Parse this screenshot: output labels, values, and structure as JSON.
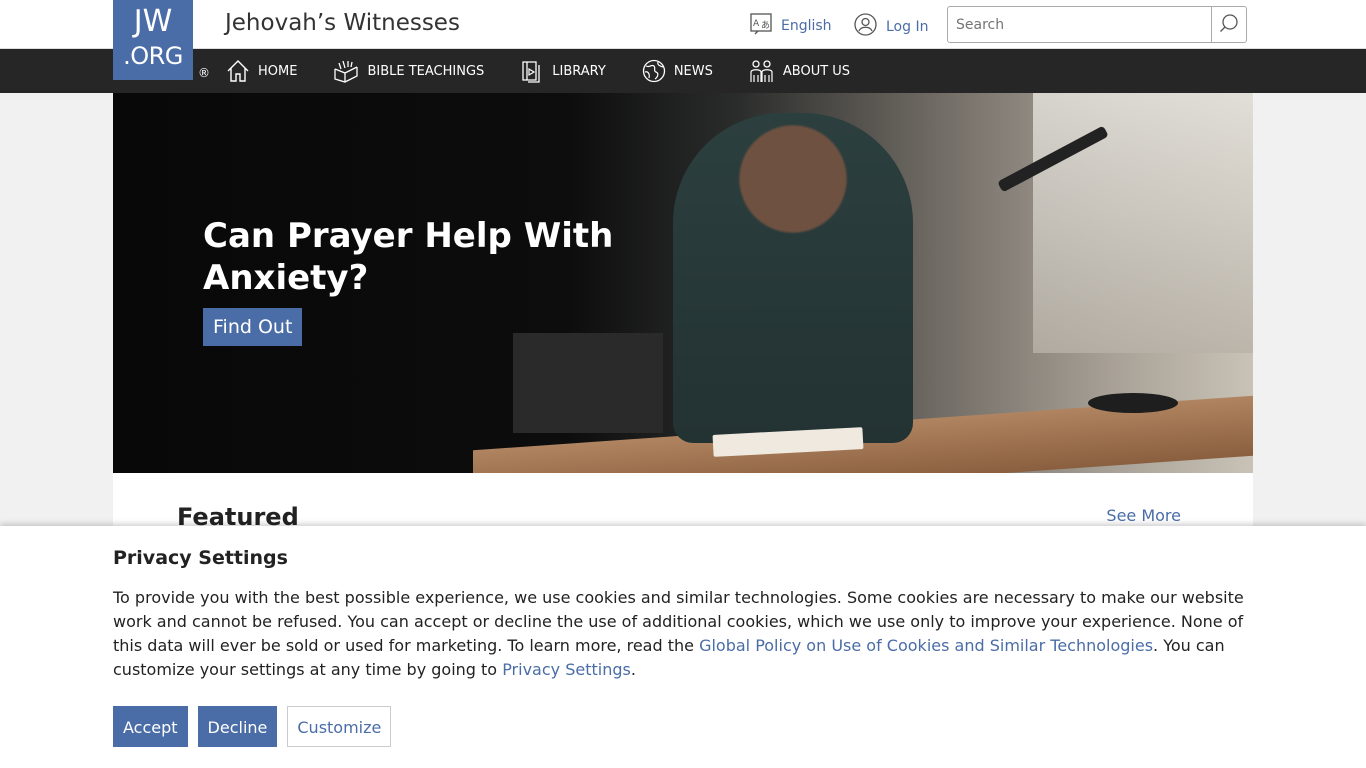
{
  "header": {
    "logo_line1": "JW",
    "logo_line2": ".ORG",
    "registered": "®",
    "site_title": "Jehovah’s Witnesses",
    "language_label": "English",
    "login_label": "Log In",
    "search_placeholder": "Search"
  },
  "nav": {
    "items": [
      {
        "label": "HOME",
        "icon": "home-icon"
      },
      {
        "label": "BIBLE TEACHINGS",
        "icon": "bible-icon"
      },
      {
        "label": "LIBRARY",
        "icon": "library-icon"
      },
      {
        "label": "NEWS",
        "icon": "globe-icon"
      },
      {
        "label": "ABOUT US",
        "icon": "people-icon"
      }
    ]
  },
  "hero": {
    "title": "Can Prayer Help With Anxiety?",
    "cta": "Find Out"
  },
  "featured": {
    "heading": "Featured",
    "see_more": "See More"
  },
  "cookie": {
    "title": "Privacy Settings",
    "text_before_link": "To provide you with the best possible experience, we use cookies and similar technologies. Some cookies are necessary to make our website work and cannot be refused. You can accept or decline the use of additional cookies, which we use only to improve your experience. None of this data will ever be sold or used for marketing. To learn more, read the ",
    "policy_link": "Global Policy on Use of Cookies and Similar Technologies",
    "text_middle": ". You can customize your settings at any time by going to ",
    "settings_link": "Privacy Settings",
    "text_end": ".",
    "accept": "Accept",
    "decline": "Decline",
    "customize": "Customize"
  },
  "colors": {
    "brand": "#4a6da7",
    "nav_bg": "#262626"
  }
}
